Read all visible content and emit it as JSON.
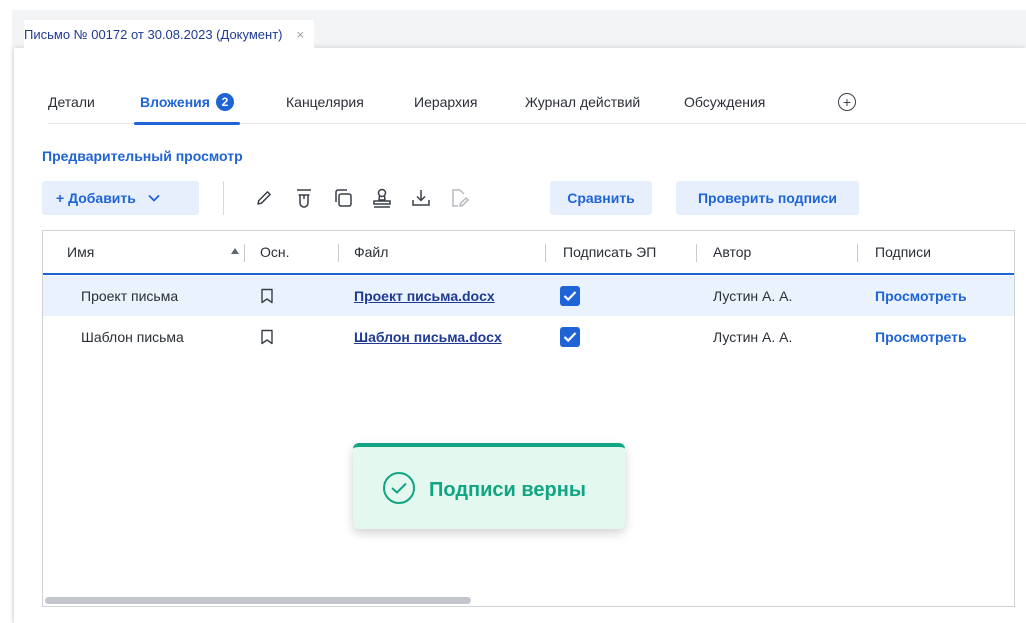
{
  "document_tab": {
    "title": "Письмо № 00172 от 30.08.2023 (Документ)",
    "close": "×"
  },
  "tabs": [
    {
      "label": "Детали"
    },
    {
      "label": "Вложения",
      "badge": "2",
      "active": true
    },
    {
      "label": "Канцелярия"
    },
    {
      "label": "Иерархия"
    },
    {
      "label": "Журнал действий"
    },
    {
      "label": "Обсуждения"
    }
  ],
  "add_tab_icon": "plus-circle-icon",
  "preview_link": "Предварительный просмотр",
  "toolbar": {
    "add_label": "+ Добавить",
    "add_dropdown": "⌄",
    "icons": [
      "pencil-icon",
      "delete-icon",
      "copy-icon",
      "stamp-icon",
      "download-icon",
      "file-edit-icon"
    ],
    "compare_label": "Сравнить",
    "check_signatures_label": "Проверить подписи"
  },
  "table": {
    "columns": [
      "Имя",
      "Осн.",
      "Файл",
      "Подписать ЭП",
      "Автор",
      "Подписи"
    ],
    "rows": [
      {
        "name": "Проект письма",
        "file": "Проект письма.docx",
        "sign": true,
        "author": "Лустин А. А.",
        "signatures": "Просмотреть",
        "selected": true
      },
      {
        "name": "Шаблон письма",
        "file": "Шаблон письма.docx",
        "sign": true,
        "author": "Лустин А. А.",
        "signatures": "Просмотреть",
        "selected": false
      }
    ]
  },
  "toast": {
    "message": "Подписи верны",
    "icon": "check-circle-icon",
    "color": "#12a583"
  },
  "colors": {
    "accent": "#1f64d6",
    "success": "#12a583"
  }
}
